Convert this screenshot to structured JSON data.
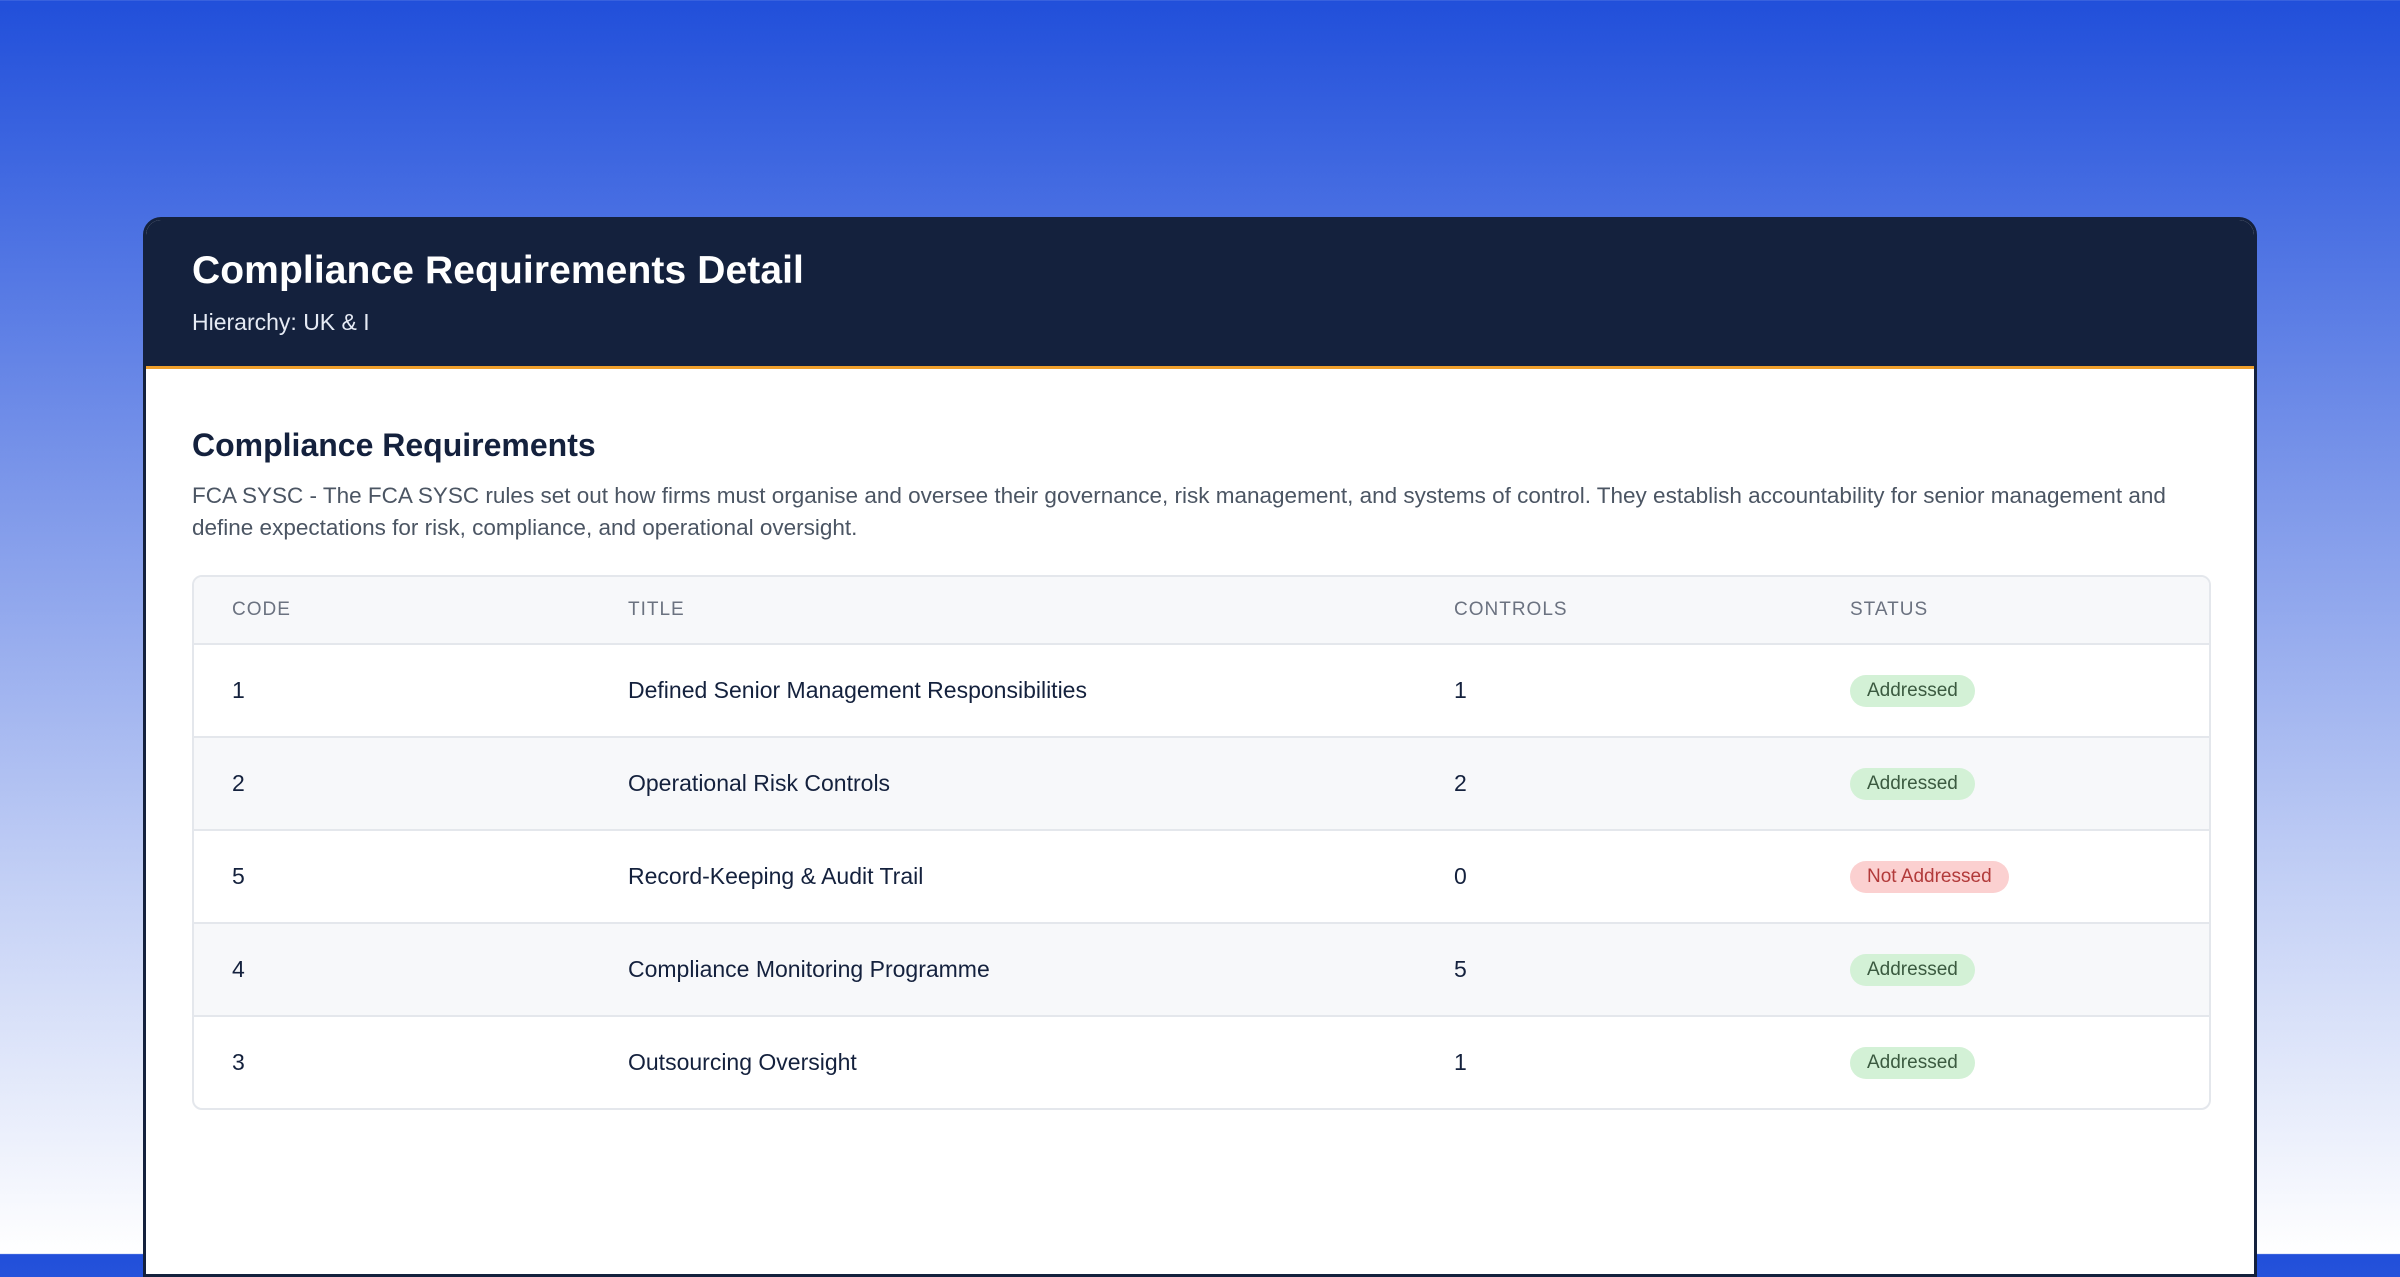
{
  "modal": {
    "title": "Compliance Requirements Detail",
    "subtitle": "Hierarchy: UK & I"
  },
  "section": {
    "title": "Compliance Requirements",
    "description": "FCA SYSC - The FCA SYSC rules set out how firms must organise and oversee their governance, risk management, and systems of control. They establish accountability for senior management and define expectations for risk, compliance, and operational oversight."
  },
  "table": {
    "headers": [
      "CODE",
      "TITLE",
      "CONTROLS",
      "STATUS"
    ],
    "rows": [
      {
        "code": "1",
        "title": "Defined Senior Management Responsibilities",
        "controls": "1",
        "status": "Addressed",
        "status_type": "addressed"
      },
      {
        "code": "2",
        "title": "Operational Risk Controls",
        "controls": "2",
        "status": "Addressed",
        "status_type": "addressed"
      },
      {
        "code": "5",
        "title": "Record-Keeping & Audit Trail",
        "controls": "0",
        "status": "Not Addressed",
        "status_type": "not-addressed"
      },
      {
        "code": "4",
        "title": "Compliance Monitoring Programme",
        "controls": "5",
        "status": "Addressed",
        "status_type": "addressed"
      },
      {
        "code": "3",
        "title": "Outsourcing Oversight",
        "controls": "1",
        "status": "Addressed",
        "status_type": "addressed"
      }
    ]
  },
  "colors": {
    "header_bg": "#14213d",
    "accent": "#f0a02c",
    "addressed_bg": "#d3f1d6",
    "not_addressed_bg": "#fbd0d0"
  }
}
